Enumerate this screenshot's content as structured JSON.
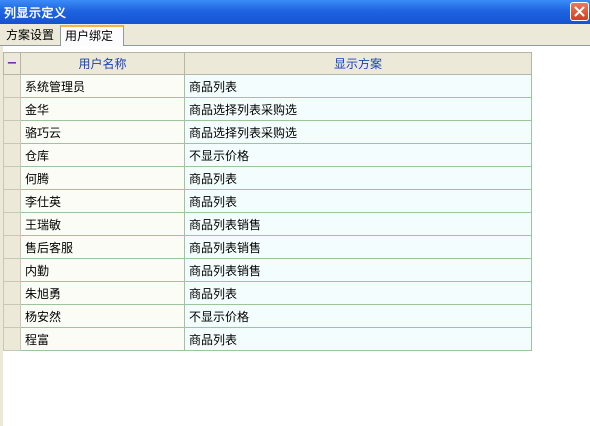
{
  "window": {
    "title": "列显示定义",
    "close_icon": "close-icon"
  },
  "tabs": [
    {
      "label": "方案设置",
      "active": false
    },
    {
      "label": "用户绑定",
      "active": true
    }
  ],
  "grid": {
    "header_indicator": "−",
    "columns": [
      "用户名称",
      "显示方案"
    ],
    "rows": [
      [
        "系统管理员",
        "商品列表"
      ],
      [
        "金华",
        "商品选择列表采购选"
      ],
      [
        "骆巧云",
        "商品选择列表采购选"
      ],
      [
        "仓库",
        "不显示价格"
      ],
      [
        "何腾",
        "商品列表"
      ],
      [
        "李仕英",
        "商品列表"
      ],
      [
        "王瑞敏",
        "商品列表销售"
      ],
      [
        "售后客服",
        "商品列表销售"
      ],
      [
        "内勤",
        "商品列表销售"
      ],
      [
        "朱旭勇",
        "商品列表"
      ],
      [
        "杨安然",
        "不显示价格"
      ],
      [
        "程富",
        "商品列表"
      ]
    ]
  },
  "colors": {
    "titlebar": "#1f64e0",
    "tab_accent": "#f0b545",
    "grid_line": "#9dc59d"
  }
}
